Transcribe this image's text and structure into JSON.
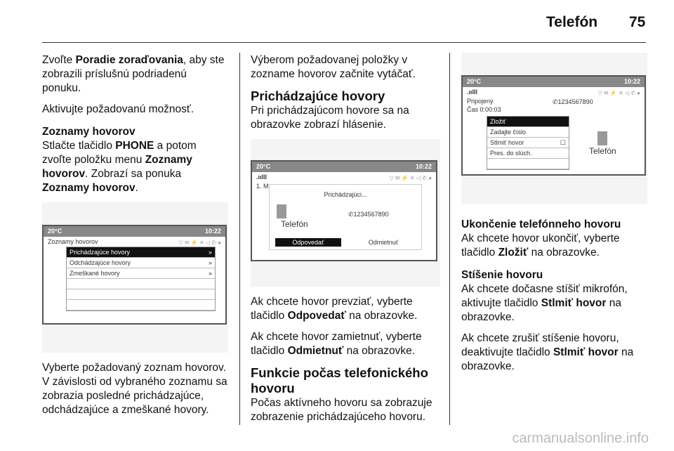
{
  "header": {
    "title": "Telefón",
    "page": "75"
  },
  "col1": {
    "p1_pre": "Zvoľte ",
    "p1_b": "Poradie zoraďovania",
    "p1_post": ", aby ste zobrazili príslušnú podriadenú ponuku.",
    "p2": "Aktivujte požadovanú možnosť.",
    "h_lists": "Zoznamy hovorov",
    "p3_a": "Stlačte tlačidlo ",
    "p3_b": "PHONE",
    "p3_c": " a potom zvoľte položku menu ",
    "p3_d": "Zoznamy hovorov",
    "p3_e": ". Zobrazí sa ponuka ",
    "p3_f": "Zoznamy hovorov",
    "p3_g": ".",
    "screen": {
      "temp": "20°C",
      "time": "10:22",
      "title": "Zoznamy hovorov",
      "items": [
        "Prichádzajúce hovory",
        "Odchádzajúce hovory",
        "Zmeškané hovory"
      ],
      "arrow": "»"
    },
    "p4": "Vyberte požadovaný zoznam hovorov. V závislosti od vybraného zoznamu sa zobrazia posledné prichádzajúce, odchádzajúce a zmeškané hovory."
  },
  "col2": {
    "p1": "Výberom požadovanej položky v zozname hovorov začnite vytáčať.",
    "h_incoming": "Prichádzajúce hovory",
    "p2": "Pri prichádzajúcom hovore sa na obrazovke zobrazí hlásenie.",
    "screen": {
      "temp": "20°C",
      "time": "10:22",
      "signal": ".ıılll",
      "behind": "1. M",
      "popup_title": "Prichádzajúci...",
      "number": "✆1234567890",
      "label": "Telefón",
      "answer": "Odpovedať",
      "reject": "Odmietnuť"
    },
    "p3_a": "Ak chcete hovor prevziať, vyberte tlačidlo ",
    "p3_b": "Odpovedať",
    "p3_c": " na obrazovke.",
    "p4_a": "Ak chcete hovor zamietnuť, vyberte tlačidlo ",
    "p4_b": "Odmietnuť",
    "p4_c": " na obrazovke.",
    "h_functions": "Funkcie počas telefonického hovoru",
    "p5": "Počas aktívneho hovoru sa zobrazuje zobrazenie prichádzajúceho hovoru."
  },
  "col3": {
    "screen": {
      "temp": "20°C",
      "time": "10:22",
      "signal": ".ıılll",
      "status": "Pripojený",
      "number": "✆1234567890",
      "duration": "Čas 0:00:03",
      "items": [
        "Zložiť",
        "Zadajte číslo",
        "Stlmiť hovor",
        "Pres. do slúch."
      ],
      "label": "Telefón"
    },
    "h_end": "Ukončenie telefónneho hovoru",
    "p1_a": "Ak chcete hovor ukončiť, vyberte tlačidlo ",
    "p1_b": "Zložiť",
    "p1_c": " na obrazovke.",
    "h_mute": "Stíšenie hovoru",
    "p2_a": "Ak chcete dočasne stíšiť mikrofón, aktivujte tlačidlo ",
    "p2_b": "Stlmiť hovor",
    "p2_c": " na obrazovke.",
    "p3_a": "Ak chcete zrušiť stíšenie hovoru, deaktivujte tlačidlo ",
    "p3_b": "Stlmiť hovor",
    "p3_c": " na obrazovke."
  },
  "watermark": "carmanualsonline.info"
}
